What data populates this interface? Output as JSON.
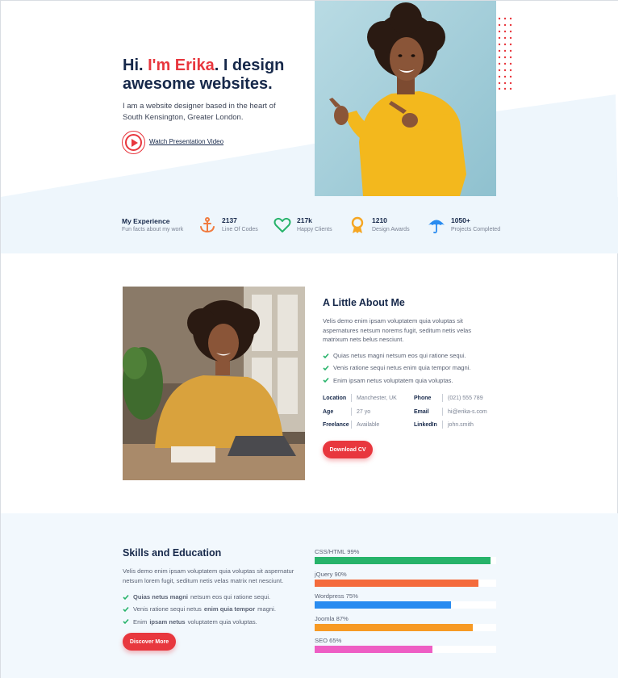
{
  "hero": {
    "title_prefix": "Hi. ",
    "title_name": "I'm Erika",
    "title_suffix": ". I design awesome websites.",
    "subtitle": "I am a website designer based in the heart of South Kensington, Greater London.",
    "video_link": "Watch Presentation Video",
    "accent_color": "#e8373e"
  },
  "stats": {
    "title": "My Experience",
    "subtitle": "Fun facts about my work",
    "items": [
      {
        "icon": "anchor-icon",
        "number": "2137",
        "label": "Line Of Codes",
        "color": "#f07b3f"
      },
      {
        "icon": "heart-icon",
        "number": "217k",
        "label": "Happy Clients",
        "color": "#27b36a"
      },
      {
        "icon": "award-icon",
        "number": "1210",
        "label": "Design Awards",
        "color": "#f5a623"
      },
      {
        "icon": "umbrella-icon",
        "number": "1050+",
        "label": "Projects Completed",
        "color": "#2a8cf0"
      }
    ]
  },
  "about": {
    "title": "A Little About Me",
    "text": "Velis demo enim ipsam voluptatem quia voluptas sit aspernatures netsum norems fugit, seditum netis velas matrixum nets belus nesciunt.",
    "checks": [
      "Quias netus magni netsum eos qui ratione sequi.",
      "Venis ratione sequi netus enim quia tempor magni.",
      "Enim ipsam netus voluptatem quia voluptas."
    ],
    "info_left": [
      {
        "key": "Location",
        "value": "Manchester, UK"
      },
      {
        "key": "Age",
        "value": "27 yo"
      },
      {
        "key": "Freelance",
        "value": "Available"
      }
    ],
    "info_right": [
      {
        "key": "Phone",
        "value": "(021) 555 789"
      },
      {
        "key": "Email",
        "value": "hi@erika-s.com"
      },
      {
        "key": "LinkedIn",
        "value": "john.smith"
      }
    ],
    "button": "Download CV"
  },
  "skills": {
    "title": "Skills and Education",
    "text": "Velis demo enim ipsam voluptatem quia voluptas sit aspernatur netsum lorem fugit, seditum netis velas matrix net nesciunt.",
    "checks": [
      {
        "a": "",
        "b": "Quias netus magni",
        "c": "netsum eos qui ratione sequi."
      },
      {
        "a": "Venis ratione sequi netus",
        "b": "enim quia tempor",
        "c": "magni."
      },
      {
        "a": "Enim",
        "b": "ipsam netus",
        "c": "voluptatem quia voluptas."
      }
    ],
    "button": "Discover More",
    "bars": [
      {
        "label": "CSS/HTML 99%",
        "percent": 97,
        "color": "#27b36a"
      },
      {
        "label": "jQuery 90%",
        "percent": 90,
        "color": "#f46b3c"
      },
      {
        "label": "Wordpress 75%",
        "percent": 75,
        "color": "#2a8cf0"
      },
      {
        "label": "Joomla 87%",
        "percent": 87,
        "color": "#f79a24"
      },
      {
        "label": "SEO 65%",
        "percent": 65,
        "color": "#ee5ec4"
      }
    ]
  }
}
